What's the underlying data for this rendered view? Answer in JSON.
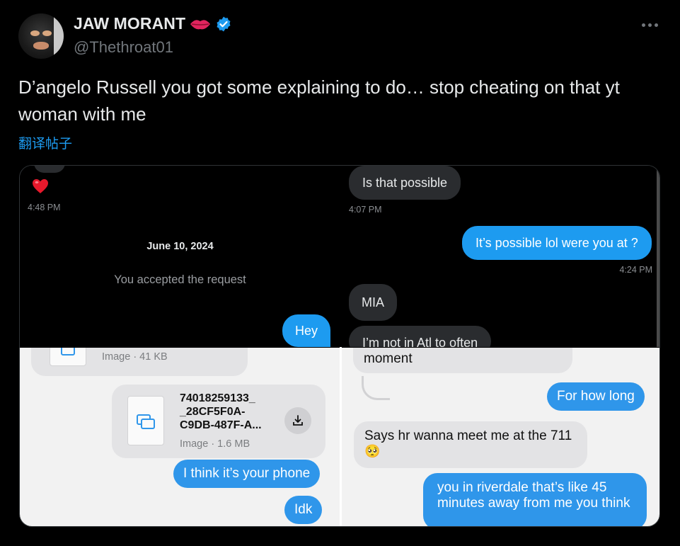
{
  "author": {
    "display_name": "JAW MORANT",
    "handle": "@Thethroat01",
    "verified": true,
    "name_emoji": "lips-icon"
  },
  "tweet": {
    "text": "D’angelo Russell you got some explaining to do… stop cheating on that yt woman with me",
    "translate_label": "翻译帖子"
  },
  "media": {
    "top_left": {
      "heart_time": "4:48 PM",
      "date_label": "June 10, 2024",
      "accepted_text": "You accepted the request",
      "outgoing": "Hey"
    },
    "top_right": {
      "incoming_1": "Is that possible",
      "time_1": "4:07 PM",
      "outgoing_1": "It’s possible lol were you at ?",
      "time_2": "4:24 PM",
      "incoming_2": "MIA",
      "incoming_3_partial": "I’m not in Atl to often"
    },
    "bottom_left": {
      "file_1_meta": "Image · 41 KB",
      "file_2_name_l1": "74018259133_",
      "file_2_name_l2": "_28CF5F0A-",
      "file_2_name_l3": "C9DB-487F-A...",
      "file_2_meta": "Image · 1.6 MB",
      "outgoing_1": "I think it’s your phone",
      "outgoing_2": "Idk"
    },
    "bottom_right": {
      "incoming_partial": "moment",
      "outgoing_1": "For how long",
      "incoming_2": "Says hr wanna meet me at the 711",
      "incoming_2_emoji": "🥺",
      "outgoing_2_l1": "you in riverdale that’s like 45",
      "outgoing_2_l2": "minutes away from me you think"
    }
  },
  "colors": {
    "accent": "#1d9bf0",
    "muted": "#71767b",
    "background": "#000000"
  }
}
